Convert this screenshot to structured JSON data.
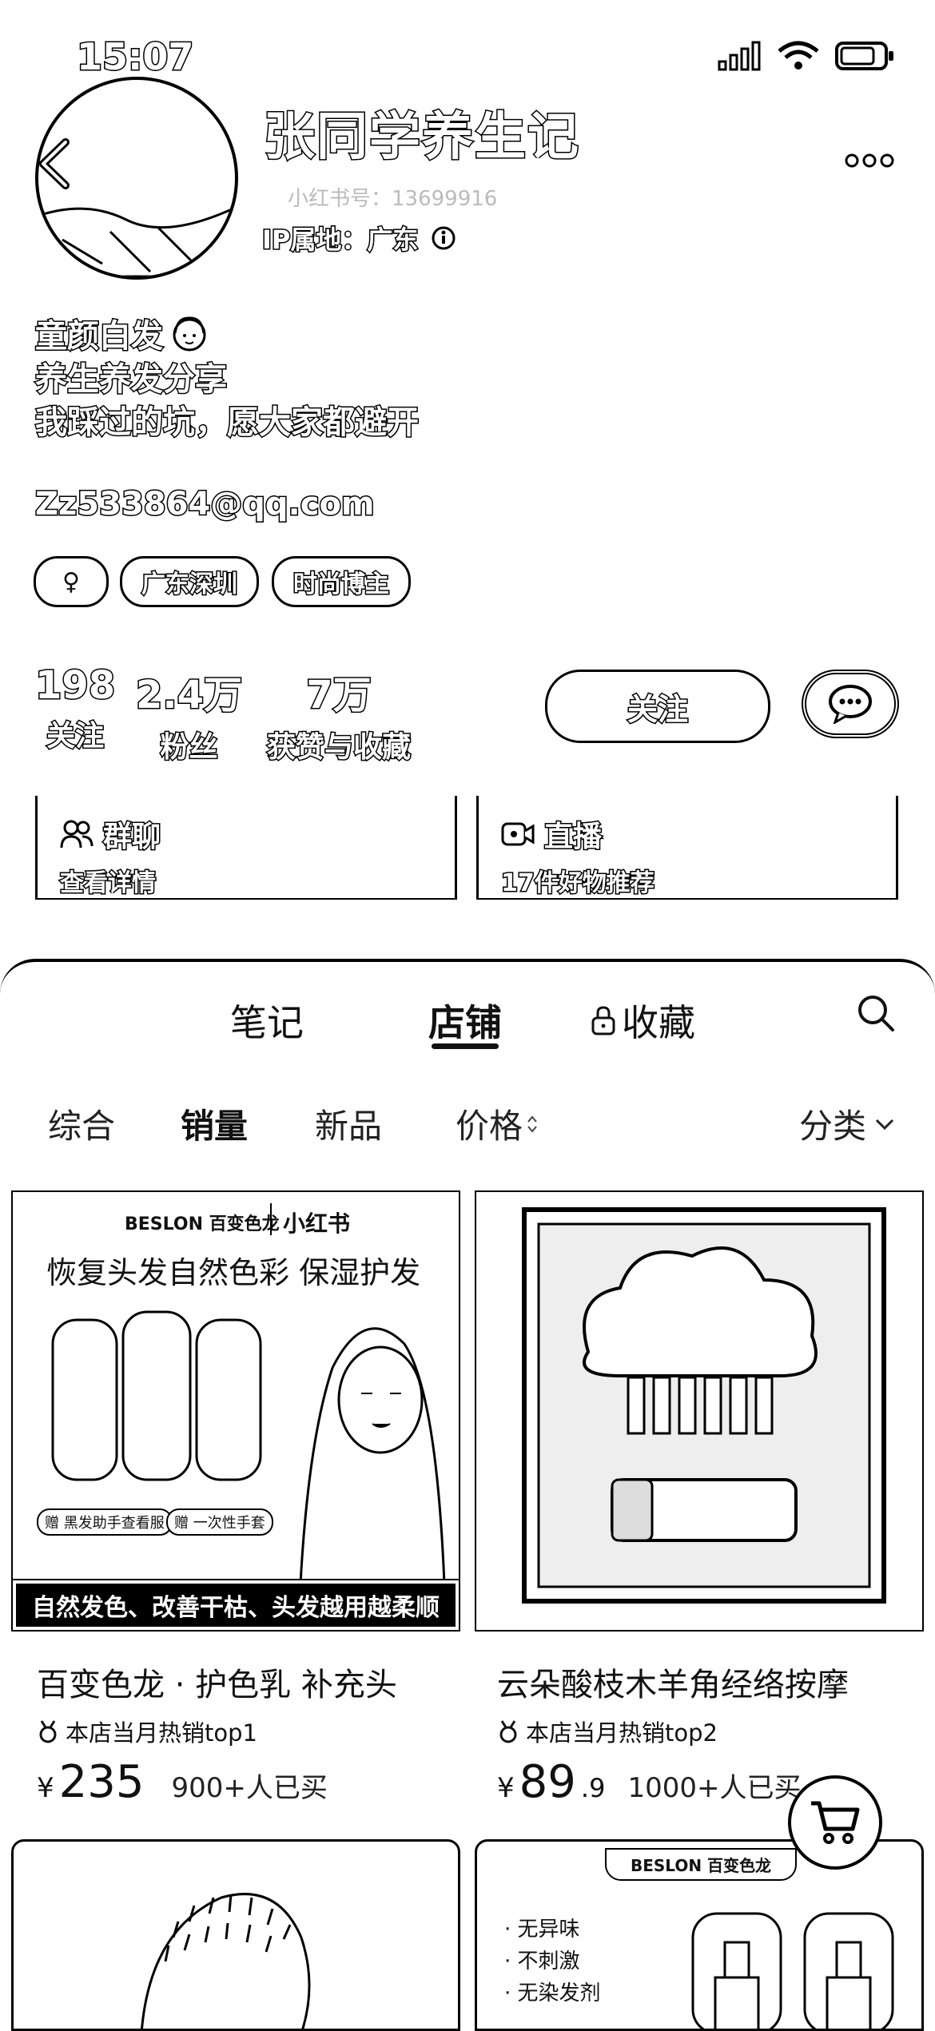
{
  "status_bar": {
    "time": "15:07"
  },
  "profile": {
    "nickname": "张同学养生记",
    "account_id": "小红书号：13699916",
    "ip_location": "IP属地：广东",
    "bio": [
      "童颜白发",
      "养生养发分享",
      "我踩过的坑，愿大家都避开"
    ],
    "email": "Zz533864@qq.com",
    "tags": [
      "♀",
      "广东深圳",
      "时尚博主"
    ],
    "stats": [
      {
        "value": "198",
        "label": "关注"
      },
      {
        "value": "2.4万",
        "label": "粉丝"
      },
      {
        "value": "7万",
        "label": "获赞与收藏"
      }
    ],
    "follow_label": "关注"
  },
  "features": [
    {
      "title": "群聊",
      "subtitle": "查看详情",
      "icon": "group-chat-icon"
    },
    {
      "title": "直播",
      "subtitle": "17件好物推荐",
      "icon": "live-video-icon"
    }
  ],
  "tabs": [
    "笔记",
    "店铺",
    "收藏"
  ],
  "active_tab": "店铺",
  "sort_options": [
    "综合",
    "销量",
    "新品",
    "价格",
    "分类"
  ],
  "products": [
    {
      "title": "百变色龙 · 护色乳 补充头",
      "badge": "本店当月热销top1",
      "price_int": "235",
      "price_dec": "",
      "sold": "900+人已买",
      "image": {
        "brand": "BESLON 百变色龙",
        "platform": "小红书",
        "headline": "恢复头发自然色彩 保湿护发",
        "gift_1": "赠 黑发助手查看服",
        "gift_2": "赠 一次性手套",
        "bottom_banner": "自然发色、改善干枯、头发越用越柔顺"
      }
    },
    {
      "title": "云朵酸枝木羊角经络按摩",
      "badge": "本店当月热销top2",
      "price_int": "89",
      "price_dec": ".9",
      "sold": "1000+人已买"
    }
  ],
  "product3": {
    "brand": "BESLON 百变色龙",
    "bullets": [
      "· 无异味",
      "· 不刺激",
      "· 无染发剂"
    ]
  },
  "currency": "¥"
}
